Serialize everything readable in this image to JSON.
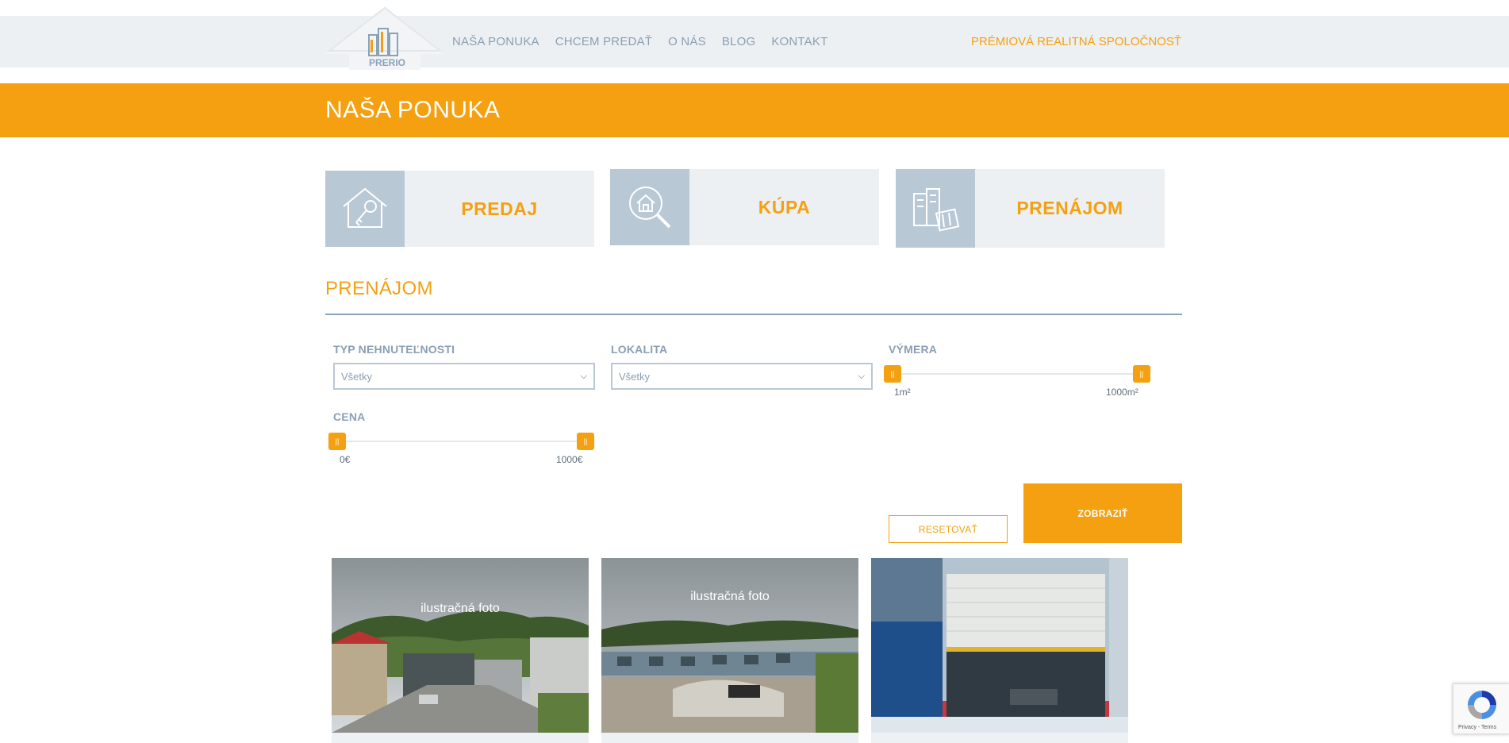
{
  "header": {
    "logo_text": "PRERIO",
    "nav": [
      "NAŠA PONUKA",
      "CHCEM PREDAŤ",
      "O NÁS",
      "BLOG",
      "KONTAKT"
    ],
    "tagline": "PRÉMIOVÁ REALITNÁ SPOLOČNOSŤ"
  },
  "page_title": "NAŠA PONUKA",
  "tiles": [
    {
      "label": "PREDAJ",
      "icon": "house-key-icon"
    },
    {
      "label": "KÚPA",
      "icon": "house-search-icon"
    },
    {
      "label": "PRENÁJOM",
      "icon": "buildings-rent-icon"
    }
  ],
  "section_title": "PRENÁJOM",
  "filters": {
    "type_label": "TYP NEHNUTEĽNOSTI",
    "type_value": "Všetky",
    "location_label": "LOKALITA",
    "location_value": "Všetky",
    "area_label": "VÝMERA",
    "area_min": "1m²",
    "area_max": "1000m²",
    "price_label": "CENA",
    "price_min": "0€",
    "price_max": "1000€",
    "handle_glyph": "||"
  },
  "buttons": {
    "reset": "RESETOVAŤ",
    "show": "ZOBRAZIŤ"
  },
  "listings": [
    {
      "caption": "ilustračná foto"
    },
    {
      "caption": "ilustračná foto"
    },
    {
      "caption": ""
    }
  ],
  "recaptcha": {
    "text": "Privacy - Terms"
  },
  "colors": {
    "accent": "#f4a011",
    "nav": "#8a9fb4",
    "tile_bg": "#edf0f2",
    "icon_bg": "#b9c8d5"
  }
}
